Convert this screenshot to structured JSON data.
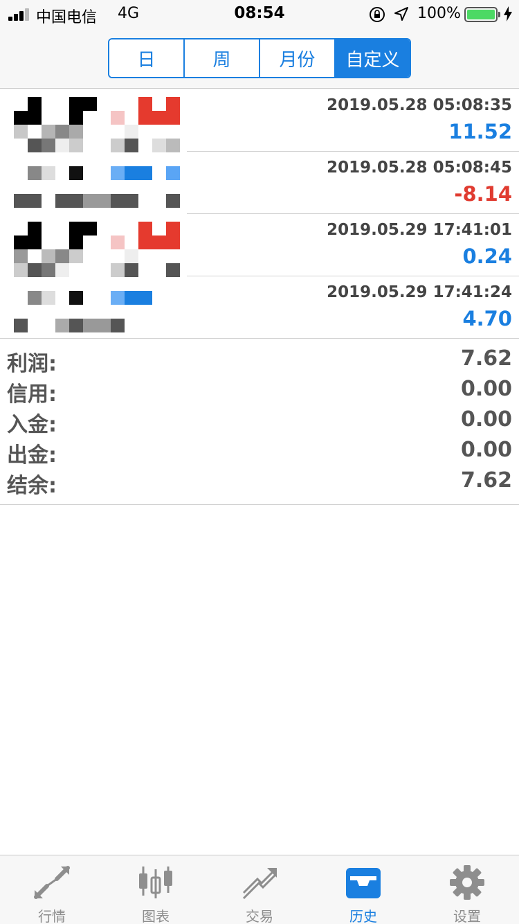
{
  "status_bar": {
    "carrier": "中国电信",
    "network": "4G",
    "time": "08:54",
    "battery": "100%"
  },
  "period_tabs": [
    {
      "label": "日",
      "active": false
    },
    {
      "label": "周",
      "active": false
    },
    {
      "label": "月份",
      "active": false
    },
    {
      "label": "自定义",
      "active": true
    }
  ],
  "deals": [
    {
      "time": "2019.05.28 05:08:35",
      "profit": "11.52",
      "sign": "pos"
    },
    {
      "time": "2019.05.28 05:08:45",
      "profit": "-8.14",
      "sign": "neg"
    },
    {
      "time": "2019.05.29 17:41:01",
      "profit": "0.24",
      "sign": "pos"
    },
    {
      "time": "2019.05.29 17:41:24",
      "profit": "4.70",
      "sign": "pos"
    }
  ],
  "summary": [
    {
      "label": "利润:",
      "value": "7.62"
    },
    {
      "label": "信用:",
      "value": "0.00"
    },
    {
      "label": "入金:",
      "value": "0.00"
    },
    {
      "label": "出金:",
      "value": "0.00"
    },
    {
      "label": "结余:",
      "value": "7.62"
    }
  ],
  "tabbar": [
    {
      "label": "行情",
      "icon": "quotes-icon",
      "active": false
    },
    {
      "label": "图表",
      "icon": "chart-icon",
      "active": false
    },
    {
      "label": "交易",
      "icon": "trade-icon",
      "active": false
    },
    {
      "label": "历史",
      "icon": "history-icon",
      "active": true
    },
    {
      "label": "设置",
      "icon": "settings-icon",
      "active": false
    }
  ],
  "colors": {
    "accent": "#1a7fe0",
    "negative": "#e03c31",
    "text_gray": "#555555"
  }
}
